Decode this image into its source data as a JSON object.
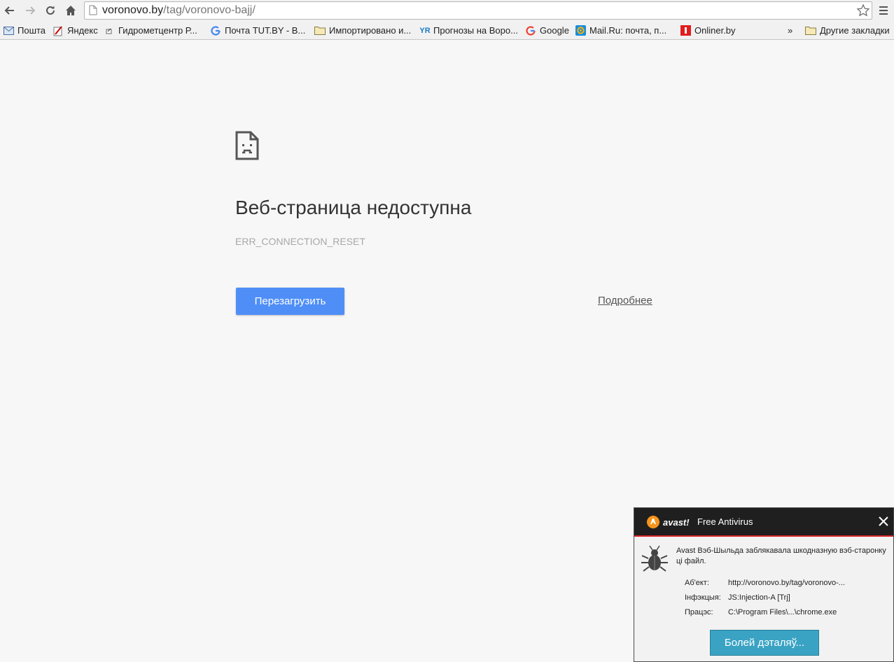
{
  "browser": {
    "url_host": "voronovo.by",
    "url_path": "/tag/voronovo-bajj/"
  },
  "bookmarks": [
    {
      "label": "Пошта",
      "icon": "mail-icon"
    },
    {
      "label": "Яндекс",
      "icon": "yandex-icon"
    },
    {
      "label": "Гидрометцентр Р...",
      "icon": "page-icon"
    },
    {
      "label": "Почта TUT.BY - В...",
      "icon": "google-icon"
    },
    {
      "label": "Импортировано и...",
      "icon": "folder-icon"
    },
    {
      "label": "Прогнозы на Воро...",
      "icon": "yr-icon",
      "icon_text": "YR"
    },
    {
      "label": "Google",
      "icon": "google-icon"
    },
    {
      "label": "Mail.Ru: почта, п...",
      "icon": "mailru-icon"
    },
    {
      "label": "Onliner.by",
      "icon": "onliner-icon"
    }
  ],
  "bookmarks_overflow": "»",
  "other_bookmarks": "Другие закладки",
  "error": {
    "title": "Веб-страница недоступна",
    "code": "ERR_CONNECTION_RESET",
    "reload_label": "Перезагрузить",
    "details_label": "Подробнее"
  },
  "avast": {
    "logo_text": "avast!",
    "product": "Free Antivirus",
    "message": "Avast Вэб-Шыльда заблякавала шкодназную вэб-старонку ці файл.",
    "rows": [
      {
        "key": "Аб'ект:",
        "value": "http://voronovo.by/tag/voronovo-..."
      },
      {
        "key": "Інфэкцыя:",
        "value": "JS:Injection-A [Trj]"
      },
      {
        "key": "Працэс:",
        "value": "C:\\Program Files\\...\\chrome.exe"
      }
    ],
    "more_label": "Болей дэталяў..."
  },
  "colors": {
    "reload_button": "#4f8ef7",
    "avast_button": "#3aa3c4",
    "avast_accent": "#d8262a",
    "avast_orange": "#f7941d"
  }
}
